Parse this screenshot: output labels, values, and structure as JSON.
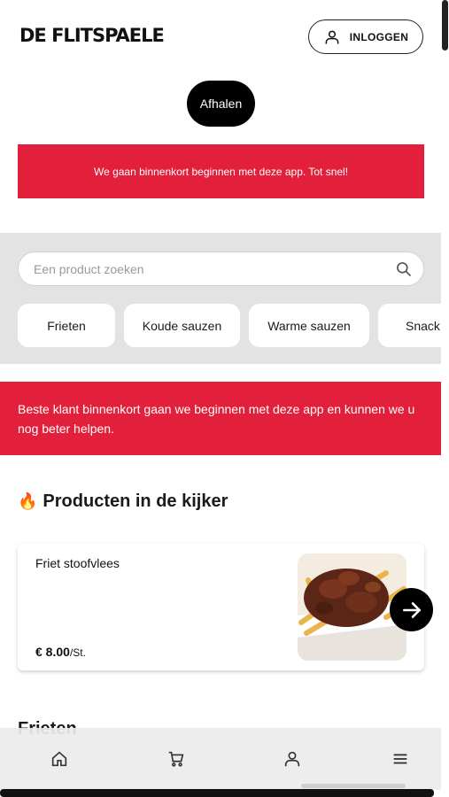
{
  "header": {
    "logo_text": "DE FLITSPAELE",
    "login_label": "INLOGGEN"
  },
  "mode_pill": {
    "label": "Afhalen"
  },
  "notice_banner": {
    "text": "We gaan binnenkort beginnen met deze app. Tot snel!"
  },
  "search": {
    "placeholder": "Een product zoeken"
  },
  "categories": [
    {
      "label": "Frieten"
    },
    {
      "label": "Koude sauzen"
    },
    {
      "label": "Warme sauzen"
    },
    {
      "label": "Snack"
    }
  ],
  "info_banner": {
    "text": "Beste klant binnenkort gaan we beginnen met deze app en kunnen we u nog beter helpen."
  },
  "featured": {
    "emoji": "🔥",
    "title": "Producten in de kijker",
    "product": {
      "name": "Friet stoofvlees",
      "price": "€ 8.00",
      "unit": "/St."
    }
  },
  "next_section": {
    "title": "Frieten"
  },
  "bottom_nav": {
    "items": [
      "home-icon",
      "cart-icon",
      "user-icon",
      "menu-icon"
    ]
  },
  "colors": {
    "accent_red": "#e2203b",
    "dark": "#000000",
    "section_grey": "#e3e3e3"
  }
}
